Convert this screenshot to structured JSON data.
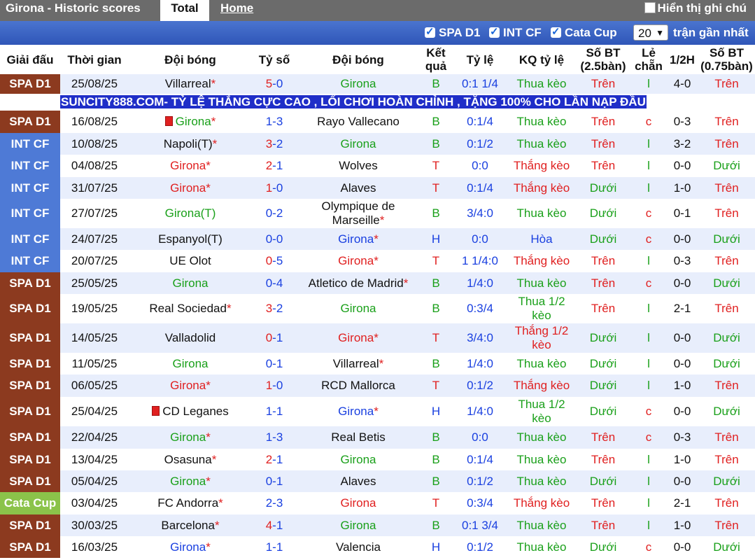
{
  "topbar": {
    "title": "Girona - Historic scores",
    "tab_total": "Total",
    "tab_home": "Home",
    "show_notes": "Hiển thị ghi chú"
  },
  "filters": {
    "spa": "SPA D1",
    "int": "INT CF",
    "cup": "Cata Cup",
    "count": "20",
    "recent": "trận gần nhất"
  },
  "headers": {
    "league": "Giải đấu",
    "date": "Thời gian",
    "home": "Đội bóng",
    "score": "Tỷ số",
    "away": "Đội bóng",
    "result": "Kết quả",
    "odds": "Tỷ lệ",
    "odds_result": "KQ tỷ lệ",
    "ou": "Số BT (2.5bàn)",
    "oe": "Lẻ chẵn",
    "half": "1/2H",
    "ou2": "Số BT (0.75bàn)"
  },
  "ad_text": "SUNCITY888.COM- TỶ LỆ THẮNG CỰC CAO , LỐI CHƠI HOÀN CHỈNH , TẶNG 100% CHO LẦN NẠP ĐẦU",
  "rows": [
    {
      "league": "SPA D1",
      "lt": "spa",
      "date": "25/08/25",
      "home": "Villarreal",
      "hc": "k",
      "hs": true,
      "score1": "5",
      "score2": "0",
      "sc": "r",
      "away": "Girona",
      "ac": "g",
      "as": false,
      "res": "B",
      "rc": "g",
      "odds": "0:1 1/4",
      "kq": "Thua kèo",
      "kqc": "g",
      "ou": "Trên",
      "ouc": "r",
      "oe": "l",
      "oec": "g",
      "half": "4-0",
      "ou2": "Trên",
      "ou2c": "r",
      "h": 28
    },
    {
      "league": "SPA D1",
      "lt": "spa",
      "date": "16/08/25",
      "home": "Girona",
      "hc": "g",
      "hs": true,
      "hflag": true,
      "score1": "1",
      "score2": "3",
      "sc": "b",
      "away": "Rayo Vallecano",
      "ac": "k",
      "as": false,
      "res": "B",
      "rc": "g",
      "odds": "0:1/4",
      "kq": "Thua kèo",
      "kqc": "g",
      "ou": "Trên",
      "ouc": "r",
      "oe": "c",
      "oec": "r",
      "half": "0-3",
      "ou2": "Trên",
      "ou2c": "r",
      "h": 32
    },
    {
      "league": "INT CF",
      "lt": "int",
      "date": "10/08/25",
      "home": "Napoli(T)",
      "hc": "k",
      "hs": true,
      "score1": "3",
      "score2": "2",
      "sc": "r",
      "away": "Girona",
      "ac": "g",
      "as": false,
      "res": "B",
      "rc": "g",
      "odds": "0:1/2",
      "kq": "Thua kèo",
      "kqc": "g",
      "ou": "Trên",
      "ouc": "r",
      "oe": "l",
      "oec": "g",
      "half": "3-2",
      "ou2": "Trên",
      "ou2c": "r",
      "h": 31
    },
    {
      "league": "INT CF",
      "lt": "int",
      "date": "04/08/25",
      "home": "Girona",
      "hc": "r",
      "hs": true,
      "score1": "2",
      "score2": "1",
      "sc": "r",
      "away": "Wolves",
      "ac": "k",
      "as": false,
      "res": "T",
      "rc": "r",
      "odds": "0:0",
      "kq": "Thắng kèo",
      "kqc": "r",
      "ou": "Trên",
      "ouc": "r",
      "oe": "l",
      "oec": "g",
      "half": "0-0",
      "ou2": "Dưới",
      "ou2c": "g",
      "h": 32
    },
    {
      "league": "INT CF",
      "lt": "int",
      "date": "31/07/25",
      "home": "Girona",
      "hc": "r",
      "hs": true,
      "score1": "1",
      "score2": "0",
      "sc": "r",
      "away": "Alaves",
      "ac": "k",
      "as": false,
      "res": "T",
      "rc": "r",
      "odds": "0:1/4",
      "kq": "Thắng kèo",
      "kqc": "r",
      "ou": "Dưới",
      "ouc": "g",
      "oe": "l",
      "oec": "g",
      "half": "1-0",
      "ou2": "Trên",
      "ou2c": "r",
      "h": 31
    },
    {
      "league": "INT CF",
      "lt": "int",
      "date": "27/07/25",
      "home": "Girona(T)",
      "hc": "g",
      "hs": false,
      "score1": "0",
      "score2": "2",
      "sc": "b",
      "away": "Olympique de Marseille",
      "ac": "k",
      "as": true,
      "awrap": true,
      "res": "B",
      "rc": "g",
      "odds": "3/4:0",
      "kq": "Thua kèo",
      "kqc": "g",
      "ou": "Dưới",
      "ouc": "g",
      "oe": "c",
      "oec": "r",
      "half": "0-1",
      "ou2": "Trên",
      "ou2c": "r",
      "h": 42
    },
    {
      "league": "INT CF",
      "lt": "int",
      "date": "24/07/25",
      "home": "Espanyol(T)",
      "hc": "k",
      "hs": false,
      "score1": "0",
      "score2": "0",
      "sc": "b",
      "away": "Girona",
      "ac": "b",
      "as": true,
      "res": "H",
      "rc": "b",
      "odds": "0:0",
      "kq": "Hòa",
      "kqc": "b",
      "ou": "Dưới",
      "ouc": "g",
      "oe": "c",
      "oec": "r",
      "half": "0-0",
      "ou2": "Dưới",
      "ou2c": "g",
      "h": 31
    },
    {
      "league": "INT CF",
      "lt": "int",
      "date": "20/07/25",
      "home": "UE Olot",
      "hc": "k",
      "hs": false,
      "score1": "0",
      "score2": "5",
      "sc": "r",
      "away": "Girona",
      "ac": "r",
      "as": true,
      "res": "T",
      "rc": "r",
      "odds": "1 1/4:0",
      "kq": "Thắng kèo",
      "kqc": "r",
      "ou": "Trên",
      "ouc": "r",
      "oe": "l",
      "oec": "g",
      "half": "0-3",
      "ou2": "Trên",
      "ou2c": "r",
      "h": 32
    },
    {
      "league": "SPA D1",
      "lt": "spa",
      "date": "25/05/25",
      "home": "Girona",
      "hc": "g",
      "hs": false,
      "score1": "0",
      "score2": "4",
      "sc": "b",
      "away": "Atletico de Madrid",
      "ac": "k",
      "as": true,
      "res": "B",
      "rc": "g",
      "odds": "1/4:0",
      "kq": "Thua kèo",
      "kqc": "g",
      "ou": "Trên",
      "ouc": "r",
      "oe": "c",
      "oec": "r",
      "half": "0-0",
      "ou2": "Dưới",
      "ou2c": "g",
      "h": 31
    },
    {
      "league": "SPA D1",
      "lt": "spa",
      "date": "19/05/25",
      "home": "Real Sociedad",
      "hc": "k",
      "hs": true,
      "score1": "3",
      "score2": "2",
      "sc": "r",
      "away": "Girona",
      "ac": "g",
      "as": false,
      "res": "B",
      "rc": "g",
      "odds": "0:3/4",
      "kq": "Thua 1/2 kèo",
      "kqwrap": true,
      "kqc": "g",
      "ou": "Trên",
      "ouc": "r",
      "oe": "l",
      "oec": "g",
      "half": "2-1",
      "ou2": "Trên",
      "ou2c": "r",
      "h": 42
    },
    {
      "league": "SPA D1",
      "lt": "spa",
      "date": "14/05/25",
      "home": "Valladolid",
      "hc": "k",
      "hs": false,
      "score1": "0",
      "score2": "1",
      "sc": "r",
      "away": "Girona",
      "ac": "r",
      "as": true,
      "res": "T",
      "rc": "r",
      "odds": "3/4:0",
      "kq": "Thắng 1/2 kèo",
      "kqwrap": true,
      "kqc": "r",
      "ou": "Dưới",
      "ouc": "g",
      "oe": "l",
      "oec": "g",
      "half": "0-0",
      "ou2": "Dưới",
      "ou2c": "g",
      "h": 42
    },
    {
      "league": "SPA D1",
      "lt": "spa",
      "date": "11/05/25",
      "home": "Girona",
      "hc": "g",
      "hs": false,
      "score1": "0",
      "score2": "1",
      "sc": "b",
      "away": "Villarreal",
      "ac": "k",
      "as": true,
      "res": "B",
      "rc": "g",
      "odds": "1/4:0",
      "kq": "Thua kèo",
      "kqc": "g",
      "ou": "Dưới",
      "ouc": "g",
      "oe": "l",
      "oec": "g",
      "half": "0-0",
      "ou2": "Dưới",
      "ou2c": "g",
      "h": 31
    },
    {
      "league": "SPA D1",
      "lt": "spa",
      "date": "06/05/25",
      "home": "Girona",
      "hc": "r",
      "hs": true,
      "score1": "1",
      "score2": "0",
      "sc": "r",
      "away": "RCD Mallorca",
      "ac": "k",
      "as": false,
      "res": "T",
      "rc": "r",
      "odds": "0:1/2",
      "kq": "Thắng kèo",
      "kqc": "r",
      "ou": "Dưới",
      "ouc": "g",
      "oe": "l",
      "oec": "g",
      "half": "1-0",
      "ou2": "Trên",
      "ou2c": "r",
      "h": 32
    },
    {
      "league": "SPA D1",
      "lt": "spa",
      "date": "25/04/25",
      "home": "CD Leganes",
      "hc": "k",
      "hs": false,
      "hflag": true,
      "score1": "1",
      "score2": "1",
      "sc": "b",
      "away": "Girona",
      "ac": "b",
      "as": true,
      "res": "H",
      "rc": "b",
      "odds": "1/4:0",
      "kq": "Thua 1/2 kèo",
      "kqwrap": true,
      "kqc": "g",
      "ou": "Dưới",
      "ouc": "g",
      "oe": "c",
      "oec": "r",
      "half": "0-0",
      "ou2": "Dưới",
      "ou2c": "g",
      "h": 42
    },
    {
      "league": "SPA D1",
      "lt": "spa",
      "date": "22/04/25",
      "home": "Girona",
      "hc": "g",
      "hs": true,
      "score1": "1",
      "score2": "3",
      "sc": "b",
      "away": "Real Betis",
      "ac": "k",
      "as": false,
      "res": "B",
      "rc": "g",
      "odds": "0:0",
      "kq": "Thua kèo",
      "kqc": "g",
      "ou": "Trên",
      "ouc": "r",
      "oe": "c",
      "oec": "r",
      "half": "0-3",
      "ou2": "Trên",
      "ou2c": "r",
      "h": 32
    },
    {
      "league": "SPA D1",
      "lt": "spa",
      "date": "13/04/25",
      "home": "Osasuna",
      "hc": "k",
      "hs": true,
      "score1": "2",
      "score2": "1",
      "sc": "r",
      "away": "Girona",
      "ac": "g",
      "as": false,
      "res": "B",
      "rc": "g",
      "odds": "0:1/4",
      "kq": "Thua kèo",
      "kqc": "g",
      "ou": "Trên",
      "ouc": "r",
      "oe": "l",
      "oec": "g",
      "half": "1-0",
      "ou2": "Trên",
      "ou2c": "r",
      "h": 31
    },
    {
      "league": "SPA D1",
      "lt": "spa",
      "date": "05/04/25",
      "home": "Girona",
      "hc": "g",
      "hs": true,
      "score1": "0",
      "score2": "1",
      "sc": "b",
      "away": "Alaves",
      "ac": "k",
      "as": false,
      "res": "B",
      "rc": "g",
      "odds": "0:1/2",
      "kq": "Thua kèo",
      "kqc": "g",
      "ou": "Dưới",
      "ouc": "g",
      "oe": "l",
      "oec": "g",
      "half": "0-0",
      "ou2": "Dưới",
      "ou2c": "g",
      "h": 31
    },
    {
      "league": "Cata Cup",
      "lt": "cup",
      "date": "03/04/25",
      "home": "FC Andorra",
      "hc": "k",
      "hs": true,
      "score1": "2",
      "score2": "3",
      "sc": "b",
      "away": "Girona",
      "ac": "r",
      "as": false,
      "res": "T",
      "rc": "r",
      "odds": "0:3/4",
      "kq": "Thắng kèo",
      "kqc": "r",
      "ou": "Trên",
      "ouc": "r",
      "oe": "l",
      "oec": "g",
      "half": "2-1",
      "ou2": "Trên",
      "ou2c": "r",
      "h": 32
    },
    {
      "league": "SPA D1",
      "lt": "spa",
      "date": "30/03/25",
      "home": "Barcelona",
      "hc": "k",
      "hs": true,
      "score1": "4",
      "score2": "1",
      "sc": "r",
      "away": "Girona",
      "ac": "g",
      "as": false,
      "res": "B",
      "rc": "g",
      "odds": "0:1 3/4",
      "kq": "Thua kèo",
      "kqc": "g",
      "ou": "Trên",
      "ouc": "r",
      "oe": "l",
      "oec": "g",
      "half": "1-0",
      "ou2": "Trên",
      "ou2c": "r",
      "h": 31
    },
    {
      "league": "SPA D1",
      "lt": "spa",
      "date": "16/03/25",
      "home": "Girona",
      "hc": "b",
      "hs": true,
      "score1": "1",
      "score2": "1",
      "sc": "b",
      "away": "Valencia",
      "ac": "k",
      "as": false,
      "res": "H",
      "rc": "b",
      "odds": "0:1/2",
      "kq": "Thua kèo",
      "kqc": "g",
      "ou": "Dưới",
      "ouc": "g",
      "oe": "c",
      "oec": "r",
      "half": "0-0",
      "ou2": "Dưới",
      "ou2c": "g",
      "h": 31
    }
  ]
}
